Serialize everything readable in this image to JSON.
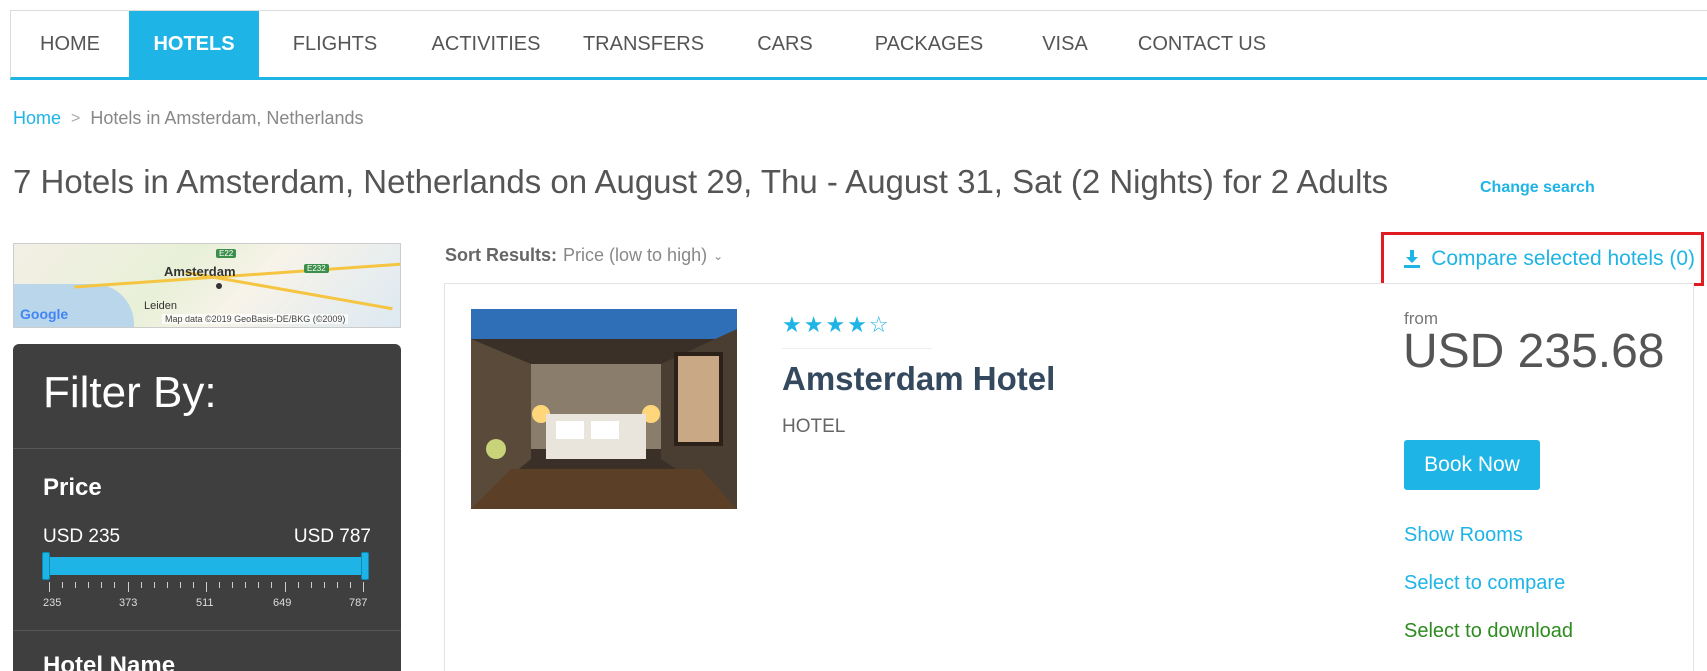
{
  "nav": {
    "items": [
      {
        "label": "HOME",
        "active": false
      },
      {
        "label": "HOTELS",
        "active": true
      },
      {
        "label": "FLIGHTS",
        "active": false
      },
      {
        "label": "ACTIVITIES",
        "active": false
      },
      {
        "label": "TRANSFERS",
        "active": false
      },
      {
        "label": "CARS",
        "active": false
      },
      {
        "label": "PACKAGES",
        "active": false
      },
      {
        "label": "VISA",
        "active": false
      },
      {
        "label": "CONTACT US",
        "active": false
      }
    ]
  },
  "breadcrumb": {
    "home": "Home",
    "separator": ">",
    "current": "Hotels in Amsterdam, Netherlands"
  },
  "header": {
    "title": "7 Hotels in Amsterdam, Netherlands on August 29, Thu - August 31, Sat (2 Nights) for 2 Adults",
    "change_search": "Change search"
  },
  "map": {
    "city": "Amsterdam",
    "nearby": "Leiden",
    "road_a": "E22",
    "road_b": "E232",
    "google": "Google",
    "attribution": "Map data ©2019 GeoBasis-DE/BKG (©2009)"
  },
  "filter": {
    "title": "Filter By:",
    "price": {
      "label": "Price",
      "min_label": "USD 235",
      "max_label": "USD 787",
      "min": 235,
      "max": 787,
      "selected_min": 235,
      "selected_max": 787,
      "ticks": [
        "235",
        "373",
        "511",
        "649",
        "787"
      ]
    },
    "hotel_name_label": "Hotel Name"
  },
  "sort": {
    "label": "Sort Results:",
    "value": "Price (low to high)"
  },
  "compare": {
    "label": "Compare selected hotels (0)",
    "icon": "download-icon"
  },
  "hotel": {
    "stars": "★★★★☆",
    "rating": 4,
    "name": "Amsterdam Hotel",
    "type": "HOTEL",
    "from_label": "from",
    "price": "USD 235.68",
    "book_label": "Book Now",
    "show_rooms": "Show Rooms",
    "select_compare": "Select to compare",
    "select_download": "Select to download"
  },
  "colors": {
    "accent": "#1eb4e6",
    "sidebar": "#3f3f3f",
    "highlight": "#e01b22",
    "download_link": "#2e8b1f"
  }
}
